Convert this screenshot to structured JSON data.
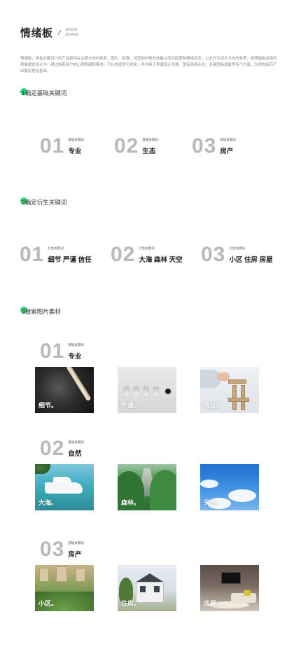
{
  "header": {
    "title": "情绪板",
    "sub_line1": "MOOD",
    "sub_line2": "BOARD"
  },
  "intro": "情绪板，是指对要设计的产品和相关主题方向的色彩、图片、影像、或其他材料的收集从而引起某种情绪反应，以此作为设计方向的参考。将情绪板运用到界面视觉设计中，通过探索用户的心理情绪和需求，可以将感受可视化，并作用于界面设计风格、图标风格走向、关键图标选取等各个方面，为视觉细节产出奠定理论基础。",
  "accent_color": "#2fd07b",
  "steps": [
    {
      "label": "1确定基础关键词"
    },
    {
      "label": "2确定衍生关键词"
    },
    {
      "label": "3搜索图片素材"
    }
  ],
  "base_keywords": [
    {
      "num": "01",
      "sub": "基础关键词",
      "word": "专业"
    },
    {
      "num": "02",
      "sub": "基础关键词",
      "word": "生态"
    },
    {
      "num": "03",
      "sub": "基础关键词",
      "word": "房产"
    }
  ],
  "derived_keywords": [
    {
      "num": "01",
      "sub": "衍生关键词",
      "words": "细节  严谨  信任"
    },
    {
      "num": "02",
      "sub": "衍生关键词",
      "words": "大海  森林  天空"
    },
    {
      "num": "03",
      "sub": "衍生关键词",
      "words": "小区  住房  房屋"
    }
  ],
  "material_groups": [
    {
      "num": "01",
      "sub": "基础关键词",
      "word": "专业",
      "images": [
        {
          "label": "细节。",
          "icon": "wire-detail-image"
        },
        {
          "label": "严谨。",
          "icon": "slots-image"
        },
        {
          "label": "信任。",
          "icon": "blocks-image"
        }
      ]
    },
    {
      "num": "02",
      "sub": "基础关键词",
      "word": "自然",
      "images": [
        {
          "label": "大海。",
          "icon": "boat-sea-image"
        },
        {
          "label": "森林。",
          "icon": "forest-image"
        },
        {
          "label": "天空。",
          "icon": "sky-image"
        }
      ]
    },
    {
      "num": "03",
      "sub": "基础关键词",
      "word": "房产",
      "images": [
        {
          "label": "小区。",
          "icon": "estate-image"
        },
        {
          "label": "住房。",
          "icon": "house-image"
        },
        {
          "label": "房屋。",
          "icon": "room-image"
        }
      ]
    }
  ]
}
